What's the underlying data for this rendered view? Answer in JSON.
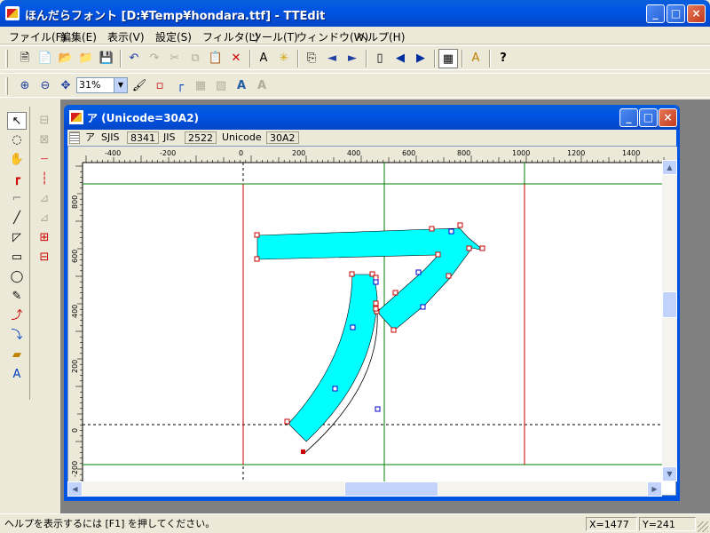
{
  "window": {
    "title": "ほんだらフォント [D:¥Temp¥hondara.ttf] - TTEdit"
  },
  "caption_buttons": {
    "minimize": "_",
    "maximize": "□",
    "close": "×"
  },
  "menu": [
    "ファイル(F)",
    "編集(E)",
    "表示(V)",
    "設定(S)",
    "フィルタ(L)",
    "ツール(T)",
    "ウィンドウ(W)",
    "ヘルプ(H)"
  ],
  "toolbar1": [
    {
      "name": "new-font-icon",
      "glyph": "🗎",
      "enabled": true
    },
    {
      "name": "new-file-icon",
      "glyph": "📄",
      "enabled": true
    },
    {
      "name": "open-folder-icon",
      "glyph": "📂",
      "enabled": true
    },
    {
      "name": "open-recent-icon",
      "glyph": "📁",
      "enabled": true
    },
    {
      "name": "save-icon",
      "glyph": "💾",
      "enabled": true
    },
    {
      "name": "undo-icon",
      "glyph": "↶",
      "enabled": true
    },
    {
      "name": "redo-icon",
      "glyph": "↷",
      "enabled": false
    },
    {
      "name": "cut-icon",
      "glyph": "✂",
      "enabled": false
    },
    {
      "name": "copy-icon",
      "glyph": "⧉",
      "enabled": false
    },
    {
      "name": "paste-icon",
      "glyph": "📋",
      "enabled": false
    },
    {
      "name": "delete-icon",
      "glyph": "✕",
      "enabled": true
    },
    {
      "name": "glyph-properties-icon",
      "glyph": "A",
      "enabled": true
    },
    {
      "name": "glyph-effect-icon",
      "glyph": "✳",
      "enabled": true
    },
    {
      "name": "import-glyph-icon",
      "glyph": "⎘",
      "enabled": true
    },
    {
      "name": "previous-glyph-icon",
      "glyph": "◄",
      "enabled": true
    },
    {
      "name": "next-glyph-icon",
      "glyph": "►",
      "enabled": true
    },
    {
      "name": "page-icon",
      "glyph": "▯",
      "enabled": true
    },
    {
      "name": "page-previous-icon",
      "glyph": "◀",
      "enabled": true
    },
    {
      "name": "page-next-icon",
      "glyph": "▶",
      "enabled": true
    },
    {
      "name": "glyph-list-icon",
      "glyph": "▦",
      "enabled": true
    },
    {
      "name": "font-info-icon",
      "glyph": "A",
      "enabled": true
    },
    {
      "name": "help-icon",
      "glyph": "?",
      "enabled": true
    }
  ],
  "toolbar2": [
    {
      "name": "zoom-in-icon",
      "glyph": "⊕",
      "enabled": true
    },
    {
      "name": "zoom-out-icon",
      "glyph": "⊖",
      "enabled": true
    },
    {
      "name": "fit-window-icon",
      "glyph": "✥",
      "enabled": true
    },
    {
      "name": "fill-icon",
      "glyph": "🖌",
      "enabled": true
    },
    {
      "name": "show-points-icon",
      "glyph": "▫",
      "enabled": true
    },
    {
      "name": "guide-lines-icon",
      "glyph": "┌",
      "enabled": true
    },
    {
      "name": "grid-icon",
      "glyph": "▦",
      "enabled": false
    },
    {
      "name": "background-image-icon",
      "glyph": "▧",
      "enabled": false
    },
    {
      "name": "glyph-preview-icon",
      "glyph": "A",
      "enabled": true
    },
    {
      "name": "outline-preview-icon",
      "glyph": "A",
      "enabled": false
    }
  ],
  "zoom": {
    "value": "31%"
  },
  "tools_left": [
    "↖",
    "◌",
    "✋",
    "┏",
    "⌐",
    "╱",
    "◸",
    "▭",
    "◯",
    "✎",
    "⤴",
    "⤵",
    "▰",
    "A"
  ],
  "tools_right": [
    "⊟",
    "⊠",
    "┈",
    "┆",
    "⊿",
    "⊿",
    "⊞",
    "⊟"
  ],
  "child": {
    "title": "ア (Unicode=30A2)",
    "char": "ア"
  },
  "info": {
    "char": "ア",
    "sjis_label": "SJIS",
    "sjis_value": "8341",
    "jis_label": "JIS",
    "jis_value": "2522",
    "unicode_label": "Unicode",
    "unicode_value": "30A2"
  },
  "ruler": {
    "h_labels": [
      "-400",
      "-200",
      "0",
      "200",
      "400",
      "600",
      "800",
      "1000",
      "1200",
      "1400"
    ],
    "v_labels": [
      "800",
      "600",
      "400",
      "200",
      "0",
      "-200"
    ]
  },
  "status": {
    "help": "ヘルプを表示するには [F1] を押してください。",
    "x": "X=1477",
    "y": "Y=241"
  },
  "colors": {
    "fill": "#00ffff",
    "guide_red": "#cc0000",
    "guide_green": "#008000"
  }
}
